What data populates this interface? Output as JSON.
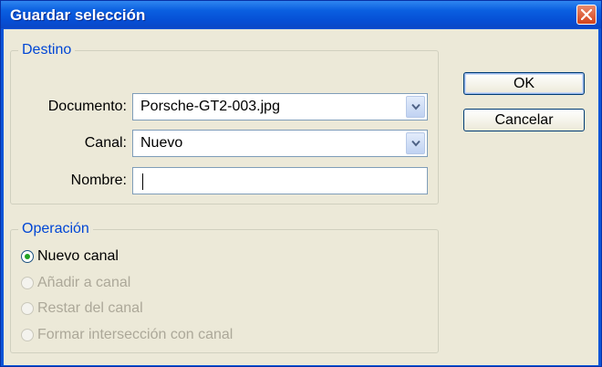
{
  "window": {
    "title": "Guardar selección"
  },
  "destino": {
    "legend": "Destino",
    "documento_label": "Documento:",
    "documento_value": "Porsche-GT2-003.jpg",
    "canal_label": "Canal:",
    "canal_value": "Nuevo",
    "nombre_label": "Nombre:",
    "nombre_value": ""
  },
  "operacion": {
    "legend": "Operación",
    "options": [
      {
        "label": "Nuevo canal",
        "checked": true,
        "enabled": true
      },
      {
        "label": "Añadir a canal",
        "checked": false,
        "enabled": false
      },
      {
        "label": "Restar del canal",
        "checked": false,
        "enabled": false
      },
      {
        "label": "Formar intersección con canal",
        "checked": false,
        "enabled": false
      }
    ]
  },
  "buttons": {
    "ok": "OK",
    "cancel": "Cancelar"
  },
  "icons": {
    "close": "close-icon",
    "dropdown": "chevron-down-icon"
  }
}
